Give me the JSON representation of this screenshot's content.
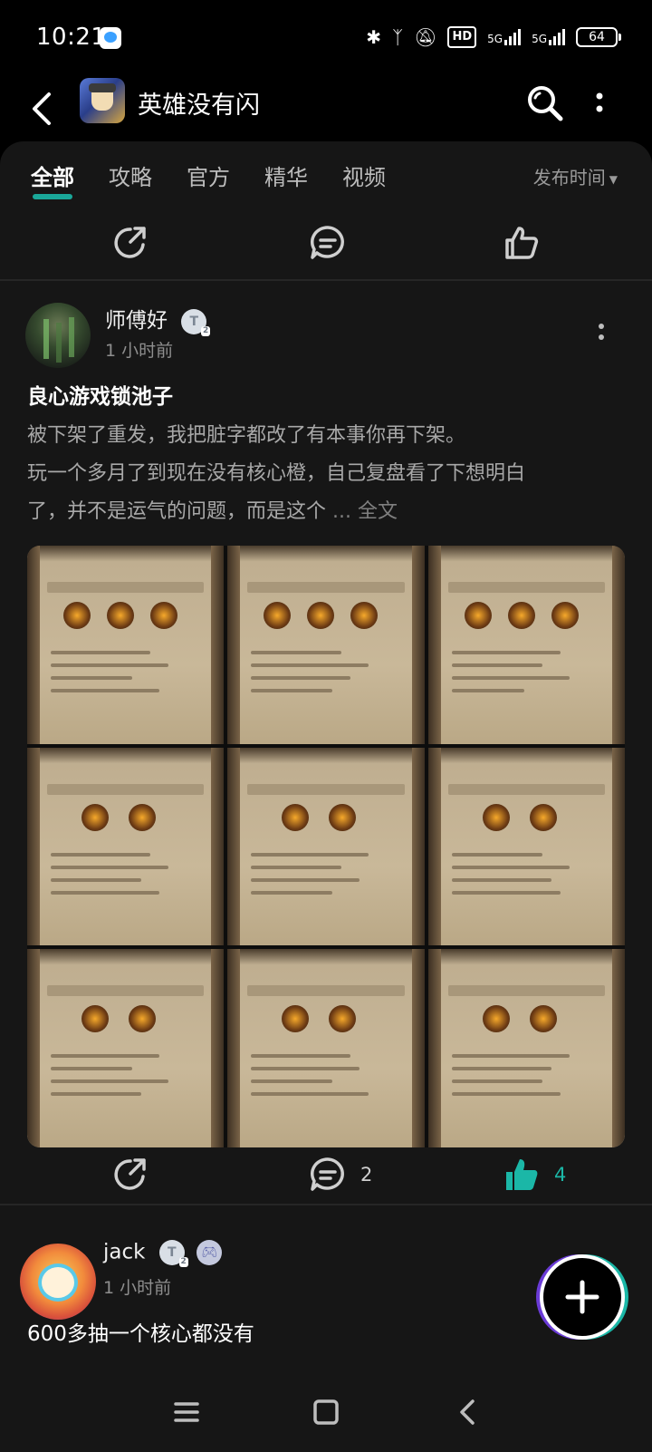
{
  "status_bar": {
    "time": "10:21",
    "hd_label": "HD",
    "signal_1": "5G",
    "signal_2": "5G",
    "battery": "64"
  },
  "header": {
    "app_title": "英雄没有闪",
    "app_icon": "game-app-icon"
  },
  "tabs": {
    "items": [
      {
        "label": "全部",
        "active": true
      },
      {
        "label": "攻略",
        "active": false
      },
      {
        "label": "官方",
        "active": false
      },
      {
        "label": "精华",
        "active": false
      },
      {
        "label": "视频",
        "active": false
      }
    ],
    "sort_label": "发布时间"
  },
  "post1": {
    "author": "师傅好",
    "level": "T",
    "level_sub": "2",
    "time_ago": "1 小时前",
    "title": "良心游戏锁池子",
    "body_line1": "被下架了重发，我把脏字都改了有本事你再下架。",
    "body_line2": "玩一个多月了到现在没有核心橙，自己复盘看了下想明白",
    "body_line3": "了，并不是运气的问题，而是这个",
    "ellipsis": "...",
    "fulltext_label": "全文",
    "comment_count": "2",
    "like_count": "4"
  },
  "post2": {
    "author": "jack",
    "level": "T",
    "level_sub": "2",
    "time_ago": "1 小时前",
    "title": "600多抽一个核心都没有"
  },
  "colors": {
    "accent": "#1bb7a7",
    "background": "#161616",
    "header_background": "#000000"
  }
}
